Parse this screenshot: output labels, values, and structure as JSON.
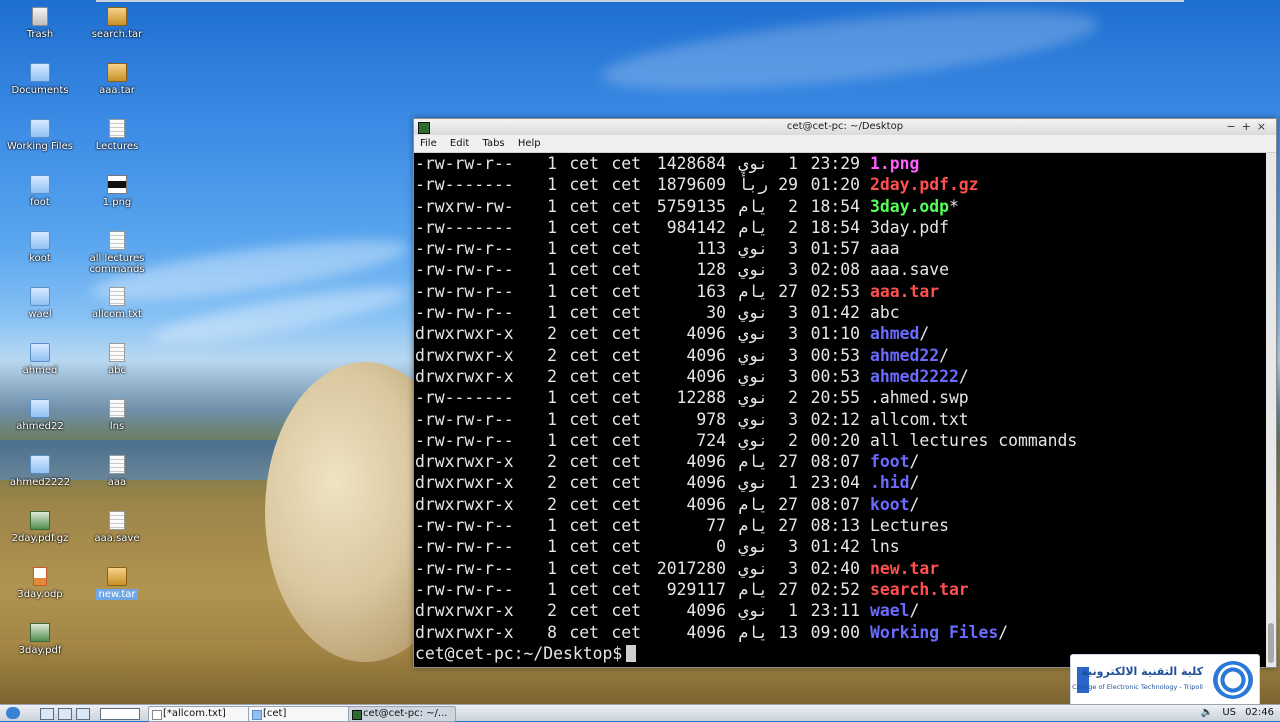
{
  "desktop": {
    "icons": [
      {
        "label": "Trash",
        "icon": "trash-icon"
      },
      {
        "label": "search.tar",
        "icon": "archive-icon"
      },
      {
        "label": "Documents",
        "icon": "folder-icon"
      },
      {
        "label": "aaa.tar",
        "icon": "archive-icon"
      },
      {
        "label": "Working Files",
        "icon": "folder-icon"
      },
      {
        "label": "Lectures",
        "icon": "text-file-icon"
      },
      {
        "label": "foot",
        "icon": "folder-icon"
      },
      {
        "label": "1.png",
        "icon": "image-file-icon"
      },
      {
        "label": "koot",
        "icon": "folder-icon"
      },
      {
        "label": "all lectures commands",
        "icon": "text-file-icon"
      },
      {
        "label": "wael",
        "icon": "folder-icon"
      },
      {
        "label": "allcom.txt",
        "icon": "text-file-icon"
      },
      {
        "label": "ahmed",
        "icon": "folder-icon"
      },
      {
        "label": "abc",
        "icon": "text-file-icon"
      },
      {
        "label": "ahmed22",
        "icon": "folder-icon"
      },
      {
        "label": "lns",
        "icon": "text-file-icon"
      },
      {
        "label": "ahmed2222",
        "icon": "folder-icon"
      },
      {
        "label": "aaa",
        "icon": "text-file-icon"
      },
      {
        "label": "2day.pdf.gz",
        "icon": "image-file-icon"
      },
      {
        "label": "aaa.save",
        "icon": "text-file-icon"
      },
      {
        "label": "3day.odp",
        "icon": "presentation-file-icon"
      },
      {
        "label": "new.tar",
        "icon": "archive-icon"
      },
      {
        "label": "3day.pdf",
        "icon": "image-file-icon"
      }
    ]
  },
  "terminal": {
    "title": "cet@cet-pc: ~/Desktop",
    "menu": [
      "File",
      "Edit",
      "Tabs",
      "Help"
    ],
    "window_controls": [
      "−",
      "+",
      "×"
    ],
    "rows": [
      {
        "perm": "-rw-rw-r--",
        "links": "1",
        "user": "cet",
        "group": "cet",
        "size": "1428684",
        "month": "نوي",
        "day": "1",
        "time": "23:29",
        "name": "1.png",
        "suffix": "",
        "kind": "img"
      },
      {
        "perm": "-rw-------",
        "links": "1",
        "user": "cet",
        "group": "cet",
        "size": "1879609",
        "month": "ربأ",
        "day": "29",
        "time": "01:20",
        "name": "2day.pdf.gz",
        "suffix": "",
        "kind": "arch"
      },
      {
        "perm": "-rwxrw-rw-",
        "links": "1",
        "user": "cet",
        "group": "cet",
        "size": "5759135",
        "month": "يام",
        "day": "2",
        "time": "18:54",
        "name": "3day.odp",
        "suffix": "*",
        "kind": "exec"
      },
      {
        "perm": "-rw-------",
        "links": "1",
        "user": "cet",
        "group": "cet",
        "size": "984142",
        "month": "يام",
        "day": "2",
        "time": "18:54",
        "name": "3day.pdf",
        "suffix": "",
        "kind": "plain"
      },
      {
        "perm": "-rw-rw-r--",
        "links": "1",
        "user": "cet",
        "group": "cet",
        "size": "113",
        "month": "نوي",
        "day": "3",
        "time": "01:57",
        "name": "aaa",
        "suffix": "",
        "kind": "plain"
      },
      {
        "perm": "-rw-rw-r--",
        "links": "1",
        "user": "cet",
        "group": "cet",
        "size": "128",
        "month": "نوي",
        "day": "3",
        "time": "02:08",
        "name": "aaa.save",
        "suffix": "",
        "kind": "plain"
      },
      {
        "perm": "-rw-rw-r--",
        "links": "1",
        "user": "cet",
        "group": "cet",
        "size": "163",
        "month": "يام",
        "day": "27",
        "time": "02:53",
        "name": "aaa.tar",
        "suffix": "",
        "kind": "arch"
      },
      {
        "perm": "-rw-rw-r--",
        "links": "1",
        "user": "cet",
        "group": "cet",
        "size": "30",
        "month": "نوي",
        "day": "3",
        "time": "01:42",
        "name": "abc",
        "suffix": "",
        "kind": "plain"
      },
      {
        "perm": "drwxrwxr-x",
        "links": "2",
        "user": "cet",
        "group": "cet",
        "size": "4096",
        "month": "نوي",
        "day": "3",
        "time": "01:10",
        "name": "ahmed",
        "suffix": "/",
        "kind": "dir"
      },
      {
        "perm": "drwxrwxr-x",
        "links": "2",
        "user": "cet",
        "group": "cet",
        "size": "4096",
        "month": "نوي",
        "day": "3",
        "time": "00:53",
        "name": "ahmed22",
        "suffix": "/",
        "kind": "dir"
      },
      {
        "perm": "drwxrwxr-x",
        "links": "2",
        "user": "cet",
        "group": "cet",
        "size": "4096",
        "month": "نوي",
        "day": "3",
        "time": "00:53",
        "name": "ahmed2222",
        "suffix": "/",
        "kind": "dir"
      },
      {
        "perm": "-rw-------",
        "links": "1",
        "user": "cet",
        "group": "cet",
        "size": "12288",
        "month": "نوي",
        "day": "2",
        "time": "20:55",
        "name": ".ahmed.swp",
        "suffix": "",
        "kind": "plain"
      },
      {
        "perm": "-rw-rw-r--",
        "links": "1",
        "user": "cet",
        "group": "cet",
        "size": "978",
        "month": "نوي",
        "day": "3",
        "time": "02:12",
        "name": "allcom.txt",
        "suffix": "",
        "kind": "plain"
      },
      {
        "perm": "-rw-rw-r--",
        "links": "1",
        "user": "cet",
        "group": "cet",
        "size": "724",
        "month": "نوي",
        "day": "2",
        "time": "00:20",
        "name": "all lectures commands",
        "suffix": "",
        "kind": "plain"
      },
      {
        "perm": "drwxrwxr-x",
        "links": "2",
        "user": "cet",
        "group": "cet",
        "size": "4096",
        "month": "يام",
        "day": "27",
        "time": "08:07",
        "name": "foot",
        "suffix": "/",
        "kind": "dir"
      },
      {
        "perm": "drwxrwxr-x",
        "links": "2",
        "user": "cet",
        "group": "cet",
        "size": "4096",
        "month": "نوي",
        "day": "1",
        "time": "23:04",
        "name": ".hid",
        "suffix": "/",
        "kind": "dir"
      },
      {
        "perm": "drwxrwxr-x",
        "links": "2",
        "user": "cet",
        "group": "cet",
        "size": "4096",
        "month": "يام",
        "day": "27",
        "time": "08:07",
        "name": "koot",
        "suffix": "/",
        "kind": "dir"
      },
      {
        "perm": "-rw-rw-r--",
        "links": "1",
        "user": "cet",
        "group": "cet",
        "size": "77",
        "month": "يام",
        "day": "27",
        "time": "08:13",
        "name": "Lectures",
        "suffix": "",
        "kind": "plain"
      },
      {
        "perm": "-rw-rw-r--",
        "links": "1",
        "user": "cet",
        "group": "cet",
        "size": "0",
        "month": "نوي",
        "day": "3",
        "time": "01:42",
        "name": "lns",
        "suffix": "",
        "kind": "plain"
      },
      {
        "perm": "-rw-rw-r--",
        "links": "1",
        "user": "cet",
        "group": "cet",
        "size": "2017280",
        "month": "نوي",
        "day": "3",
        "time": "02:40",
        "name": "new.tar",
        "suffix": "",
        "kind": "arch"
      },
      {
        "perm": "-rw-rw-r--",
        "links": "1",
        "user": "cet",
        "group": "cet",
        "size": "929117",
        "month": "يام",
        "day": "27",
        "time": "02:52",
        "name": "search.tar",
        "suffix": "",
        "kind": "arch"
      },
      {
        "perm": "drwxrwxr-x",
        "links": "2",
        "user": "cet",
        "group": "cet",
        "size": "4096",
        "month": "نوي",
        "day": "1",
        "time": "23:11",
        "name": "wael",
        "suffix": "/",
        "kind": "dir"
      },
      {
        "perm": "drwxrwxr-x",
        "links": "8",
        "user": "cet",
        "group": "cet",
        "size": "4096",
        "month": "يام",
        "day": "13",
        "time": "09:00",
        "name": "Working Files",
        "suffix": "/",
        "kind": "dir"
      }
    ],
    "prompt": "cet@cet-pc:~/Desktop$"
  },
  "logo": {
    "arabic": "كلية التقنية الالكترونية",
    "english": "College of Electronic Technology - Tripoli"
  },
  "taskbar": {
    "items": [
      "[*allcom.txt]",
      "[cet]",
      "cet@cet-pc: ~/..."
    ],
    "layout": "US",
    "clock": "02:46"
  },
  "colors": {
    "dir": "#6b6bff",
    "archive": "#ff4f4f",
    "image": "#ff5fff",
    "exec": "#55ff55"
  }
}
